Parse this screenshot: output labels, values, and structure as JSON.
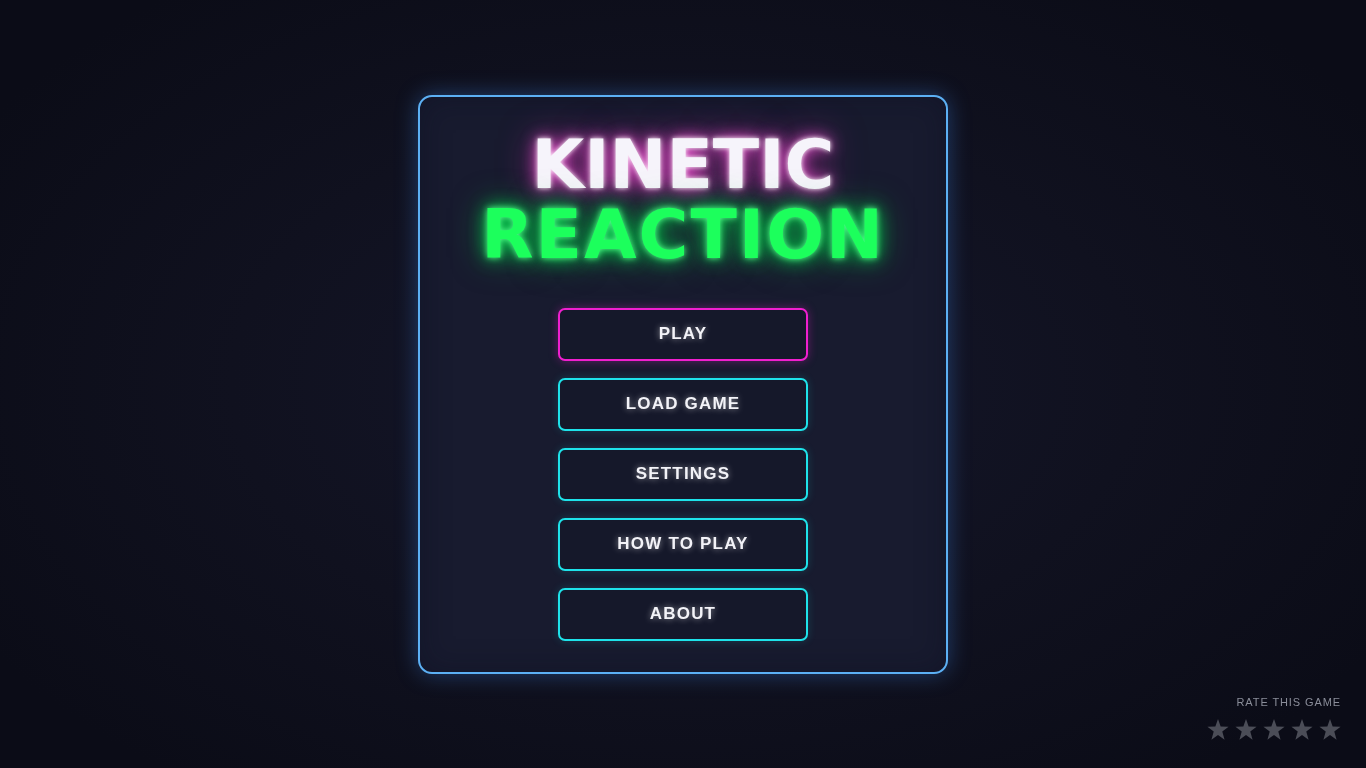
{
  "title": {
    "top": "KINETIC",
    "bottom": "REACTION"
  },
  "menu": [
    {
      "label": "PLAY",
      "selected": true
    },
    {
      "label": "LOAD GAME",
      "selected": false
    },
    {
      "label": "SETTINGS",
      "selected": false
    },
    {
      "label": "HOW TO PLAY",
      "selected": false
    },
    {
      "label": "ABOUT",
      "selected": false
    }
  ],
  "rating": {
    "label": "RATE THIS GAME",
    "stars": 0
  }
}
